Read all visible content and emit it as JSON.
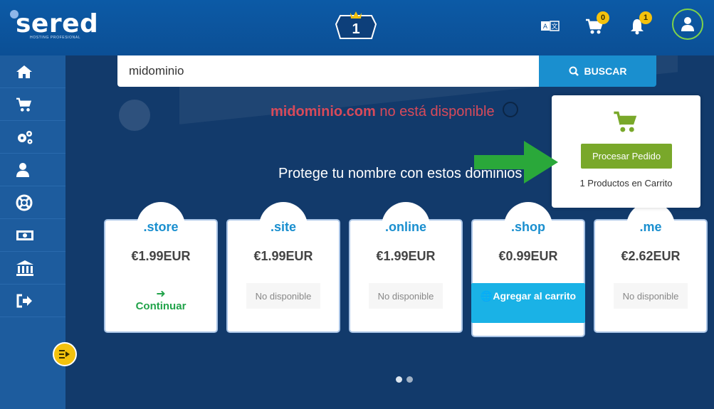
{
  "header": {
    "brand": "sered",
    "brand_sub": "HOSTING PROFESIONAL",
    "rank": "1",
    "cart_count": "0",
    "notif_count": "1"
  },
  "sidebar": {
    "items": [
      {
        "icon": "home-icon"
      },
      {
        "icon": "cart-icon"
      },
      {
        "icon": "gears-icon"
      },
      {
        "icon": "user-icon"
      },
      {
        "icon": "support-icon"
      },
      {
        "icon": "billing-icon"
      },
      {
        "icon": "bank-icon"
      },
      {
        "icon": "logout-icon"
      }
    ]
  },
  "search": {
    "value": "midominio",
    "button_label": "BUSCAR"
  },
  "result": {
    "domain": "midominio.com",
    "status": " no está disponible"
  },
  "suggest_title": "Protege tu nombre con estos dominios",
  "cart_panel": {
    "button_label": "Procesar Pedido",
    "count_text": "1 Productos en Carrito"
  },
  "domains": [
    {
      "tld": ".store",
      "price": "€1.99EUR",
      "action": "continue",
      "action_label": "Continuar"
    },
    {
      "tld": ".site",
      "price": "€1.99EUR",
      "action": "none",
      "action_label": "No disponible"
    },
    {
      "tld": ".online",
      "price": "€1.99EUR",
      "action": "none",
      "action_label": "No disponible"
    },
    {
      "tld": ".shop",
      "price": "€0.99EUR",
      "action": "add",
      "action_label": "Agregar al carrito"
    },
    {
      "tld": ".me",
      "price": "€2.62EUR",
      "action": "none",
      "action_label": "No disponible"
    }
  ],
  "colors": {
    "header": "#0b4f95",
    "sidebar": "#1d5c9e",
    "main": "#123a6b",
    "accent": "#1a8fcf",
    "cart_green": "#79a82a",
    "unavailable_red": "#d84a5a"
  }
}
